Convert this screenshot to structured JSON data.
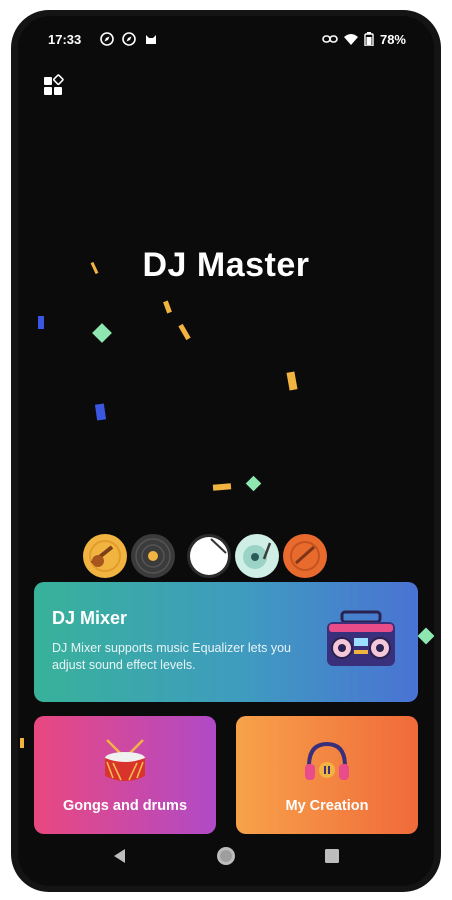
{
  "status_bar": {
    "time": "17:33",
    "battery": "78%",
    "icons": [
      "compass-icon",
      "compass-icon",
      "cat-icon",
      "link-icon",
      "wifi-icon",
      "battery-icon"
    ]
  },
  "app": {
    "title": "DJ Master",
    "menu_icon": "apps-grid-icon"
  },
  "discs": [
    "guitar-disc",
    "vinyl-disc",
    "drum-disc",
    "turntable-disc",
    "guitar-disc-2"
  ],
  "mixer_card": {
    "title": "DJ Mixer",
    "description": "DJ Mixer supports music Equalizer lets you adjust sound effect levels.",
    "icon": "boombox-icon"
  },
  "cards": {
    "gongs": {
      "label": "Gongs and drums",
      "icon": "drum-icon"
    },
    "creation": {
      "label": "My Creation",
      "icon": "headphones-icon"
    }
  },
  "nav": {
    "back": "back-icon",
    "home": "home-icon",
    "recents": "recents-icon"
  },
  "colors": {
    "background": "#0b0b0b",
    "mixer_gradient": [
      "#38b29a",
      "#4a73d4"
    ],
    "gongs_gradient": [
      "#e9487f",
      "#b04ac7"
    ],
    "creation_gradient": [
      "#f7a24a",
      "#f06a3a"
    ],
    "confetti": [
      "#f2b441",
      "#3b56e0",
      "#8ee6b0"
    ]
  }
}
